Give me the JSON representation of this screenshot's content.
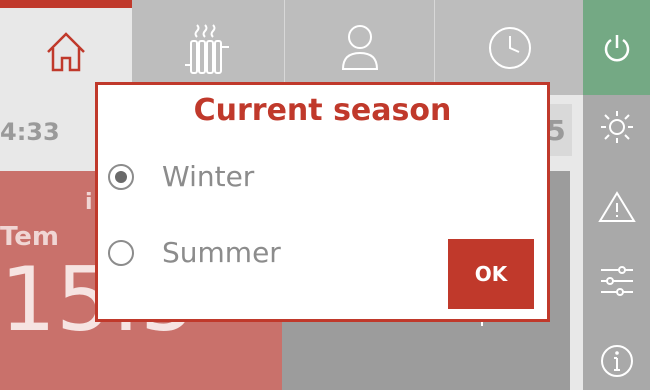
{
  "nav": {
    "tabs": [
      {
        "name": "home",
        "icon": "home-icon"
      },
      {
        "name": "heating",
        "icon": "radiator-icon"
      },
      {
        "name": "user",
        "icon": "user-icon"
      },
      {
        "name": "schedule",
        "icon": "clock-icon"
      }
    ]
  },
  "sidebar": {
    "items": [
      {
        "icon": "power-icon"
      },
      {
        "icon": "season-sun-snow-icon"
      },
      {
        "icon": "warning-icon"
      },
      {
        "icon": "settings-sliders-icon"
      },
      {
        "icon": "info-icon"
      }
    ]
  },
  "background": {
    "time": "4:33",
    "badge": "5",
    "temp_label": "Tem",
    "temp_value": "15.5",
    "temp_small": "i"
  },
  "dialog": {
    "title": "Current season",
    "options": [
      {
        "label": "Winter",
        "selected": true
      },
      {
        "label": "Summer",
        "selected": false
      }
    ],
    "ok_label": "OK"
  },
  "colors": {
    "accent": "#c0392b",
    "power": "#74a984",
    "sidebar": "#a9a9a9",
    "topbar": "#bdbdbd"
  }
}
